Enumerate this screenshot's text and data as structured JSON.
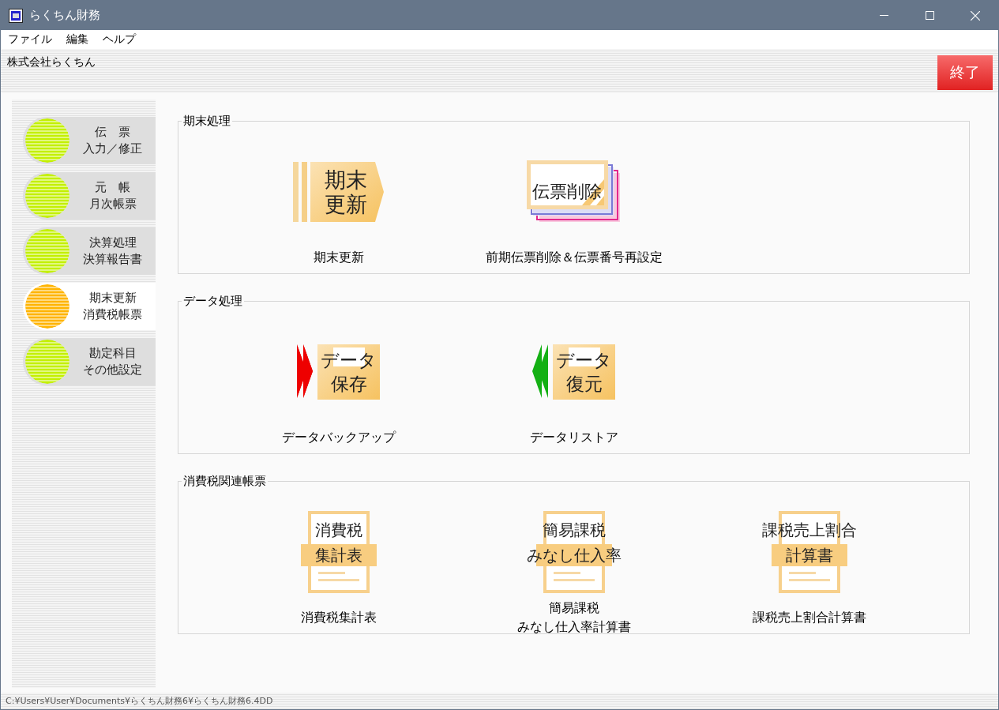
{
  "window": {
    "title": "らくちん財務"
  },
  "menu": [
    "ファイル",
    "編集",
    "ヘルプ"
  ],
  "header": {
    "company": "株式会社らくちん",
    "exit_button": "終了"
  },
  "sidebar": {
    "items": [
      {
        "lines": [
          "伝　票",
          "入力／修正"
        ],
        "selected": false
      },
      {
        "lines": [
          "元　帳",
          "月次帳票"
        ],
        "selected": false
      },
      {
        "lines": [
          "決算処理",
          "決算報告書"
        ],
        "selected": false
      },
      {
        "lines": [
          "期末更新",
          "消費税帳票"
        ],
        "selected": true
      },
      {
        "lines": [
          "勘定科目",
          "その他設定"
        ],
        "selected": false
      }
    ]
  },
  "sections": [
    {
      "title": "期末処理",
      "items": [
        {
          "kind": "tag",
          "icon_lines": [
            "期末",
            "更新"
          ],
          "caption": [
            "期末更新"
          ]
        },
        {
          "kind": "cards",
          "icon_lines": [
            "伝票削除"
          ],
          "caption": [
            "前期伝票削除＆伝票番号再設定"
          ]
        }
      ]
    },
    {
      "title": "データ処理",
      "items": [
        {
          "kind": "save",
          "icon_lines": [
            "データ",
            "保存"
          ],
          "caption": [
            "データバックアップ"
          ]
        },
        {
          "kind": "restore",
          "icon_lines": [
            "データ",
            "復元"
          ],
          "caption": [
            "データリストア"
          ]
        }
      ]
    },
    {
      "title": "消費税関連帳票",
      "items": [
        {
          "kind": "doc",
          "icon_lines": [
            "消費税",
            "集計表"
          ],
          "caption": [
            "消費税集計表"
          ]
        },
        {
          "kind": "doc",
          "icon_lines": [
            "簡易課税",
            "みなし仕入率"
          ],
          "caption": [
            "簡易課税",
            "みなし仕入率計算書"
          ]
        },
        {
          "kind": "doc",
          "icon_lines": [
            "課税売上割合",
            "計算書"
          ],
          "caption": [
            "課税売上割合計算書"
          ]
        }
      ]
    }
  ],
  "status_bar": {
    "path": "C:¥Users¥User¥Documents¥らくちん財務6¥らくちん財務6.4DD"
  }
}
